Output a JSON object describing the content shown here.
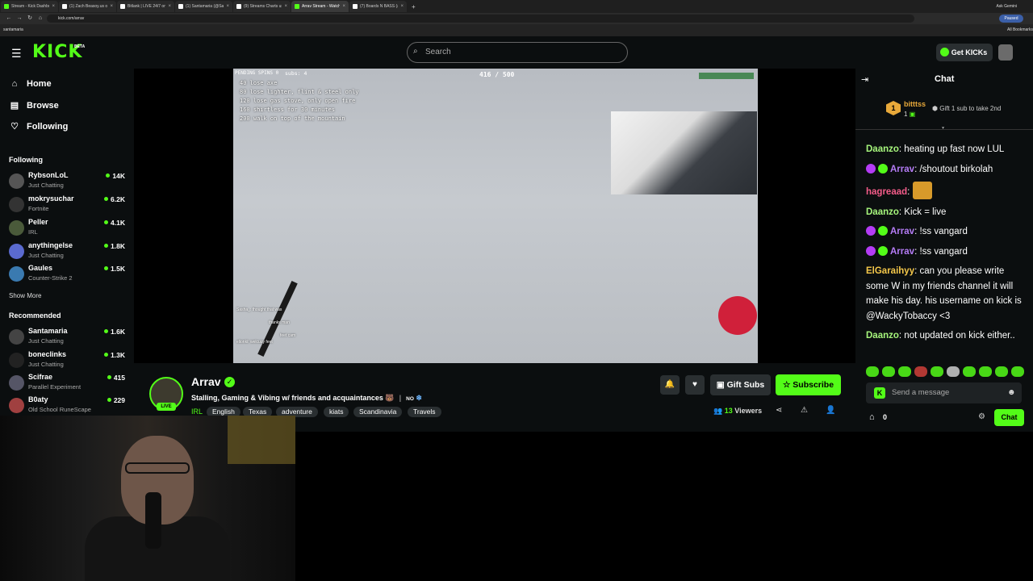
{
  "browser": {
    "tabs": [
      {
        "label": "Stream - Kick Dashboard"
      },
      {
        "label": "(1) Zach Beasoy.us on X: \"Fact"
      },
      {
        "label": "Bitlank | LIVE 24/7 on X: \"We"
      },
      {
        "label": "(1) Santamaria (@Santamaria)"
      },
      {
        "label": "(9) Streams Charts us on X:"
      },
      {
        "label": "Arrav Stream - Watch Live"
      },
      {
        "label": "(7) Boards N BASS (@BoardsN"
      }
    ],
    "url": "kick.com/arrav",
    "bookmark_left": "santamaria",
    "bookmark_right": "All Bookmarks",
    "ask_gemini": "Ask Gemini",
    "paused": "Paused"
  },
  "header": {
    "logo": "KICK",
    "logo_badge": "BETA",
    "search_placeholder": "Search",
    "get_kicks": "Get KICKs"
  },
  "sidebar": {
    "nav": [
      {
        "label": "Home",
        "icon": "home-icon"
      },
      {
        "label": "Browse",
        "icon": "browse-icon"
      },
      {
        "label": "Following",
        "icon": "heart-icon"
      }
    ],
    "following_title": "Following",
    "following": [
      {
        "name": "RybsonLoL",
        "category": "Just Chatting",
        "viewers": "14K"
      },
      {
        "name": "mokrysuchar",
        "category": "Fortnite",
        "viewers": "6.2K"
      },
      {
        "name": "Peller",
        "category": "IRL",
        "viewers": "4.1K"
      },
      {
        "name": "anythingelse",
        "category": "Just Chatting",
        "viewers": "1.8K"
      },
      {
        "name": "Gaules",
        "category": "Counter-Strike 2",
        "viewers": "1.5K"
      }
    ],
    "show_more": "Show More",
    "recommended_title": "Recommended",
    "recommended": [
      {
        "name": "Santamaria",
        "category": "Just Chatting",
        "viewers": "1.6K"
      },
      {
        "name": "boneclinks",
        "category": "Just Chatting",
        "viewers": "1.3K"
      },
      {
        "name": "Scifrae",
        "category": "Parallel Experiment",
        "viewers": "415"
      },
      {
        "name": "B0aty",
        "category": "Old School RuneScape",
        "viewers": "229"
      }
    ]
  },
  "video": {
    "pending": "PENDING SPINS 0",
    "subs": "subs: 4",
    "progress_text": "416 / 500",
    "goals": [
      "40 lose axe",
      "80 lose lighter, flint & steel only",
      "120 lose gas stove, only open fire",
      "160 shirtless for 30 minutes",
      "200 walk on top of the mountain"
    ],
    "overlay_chat": [
      "Sasha_: thought that was",
      "thanks man",
      "feet cam",
      "elionki: welcuuy feet"
    ]
  },
  "stream": {
    "streamer": "Arrav",
    "live_label": "LIVE",
    "title": "Stalling, Gaming & Vibing w/ friends and acquaintances 🐻",
    "lang_flag": "NO",
    "category": "IRL",
    "tags": [
      "English",
      "Texas",
      "adventure",
      "kiats",
      "Scandinavia",
      "Travels"
    ],
    "gift_subs": "Gift Subs",
    "subscribe": "Subscribe",
    "viewers_count": "13",
    "viewers_label": "Viewers"
  },
  "chat": {
    "title": "Chat",
    "pinned_rank": "1",
    "pinned_user": "bitttss",
    "pinned_count": "1",
    "pinned_gift": "Gift 1 sub to take 2nd",
    "messages": [
      {
        "user": "Daanzo",
        "text": "heating up fast now LUL",
        "color": "#a6f57c"
      },
      {
        "user": "Arrav",
        "text": "/shoutout birkolah",
        "color": "#b47cf5"
      },
      {
        "user": "hagreaad",
        "text": "",
        "color": "#f55c8a"
      },
      {
        "user": "Daanzo",
        "text": "Kick = live",
        "color": "#a6f57c"
      },
      {
        "user": "Arrav",
        "text": "!ss vangard",
        "color": "#b47cf5"
      },
      {
        "user": "Arrav",
        "text": "!ss vangard",
        "color": "#b47cf5"
      },
      {
        "user": "ElGaraihyy",
        "text": "can you please write some W in my friends channel it will make his day. his username on kick is @WackyTobaccy <3",
        "color": "#f5c84a"
      },
      {
        "user": "Daanzo",
        "text": "not updated on kick either..",
        "color": "#a6f57c"
      }
    ],
    "send_placeholder": "Send a message",
    "store_count": "0",
    "chat_button": "Chat"
  }
}
